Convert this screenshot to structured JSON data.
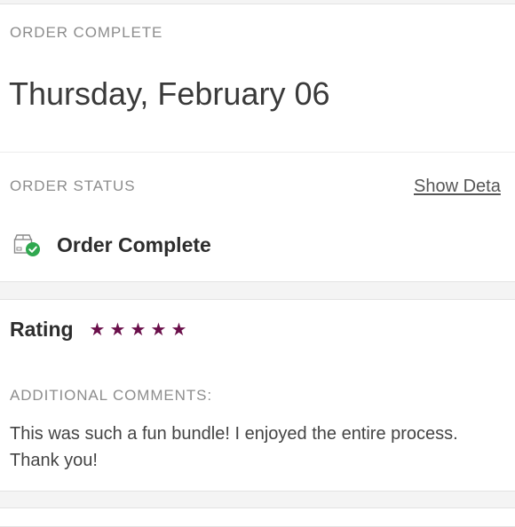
{
  "order": {
    "header_label": "ORDER COMPLETE",
    "date": "Thursday, February 06",
    "status_label": "ORDER STATUS",
    "show_details_label": "Show Deta",
    "status_text": "Order Complete"
  },
  "rating": {
    "label": "Rating",
    "stars": [
      "★",
      "★",
      "★",
      "★",
      "★"
    ],
    "star_color": "#6a0f4a",
    "comments_label": "ADDITIONAL COMMENTS:",
    "comments_text": "This was such a fun bundle! I enjoyed the entire process. Thank you!"
  },
  "icons": {
    "status_icon": "box-check-icon",
    "check_color": "#2fa84f"
  }
}
